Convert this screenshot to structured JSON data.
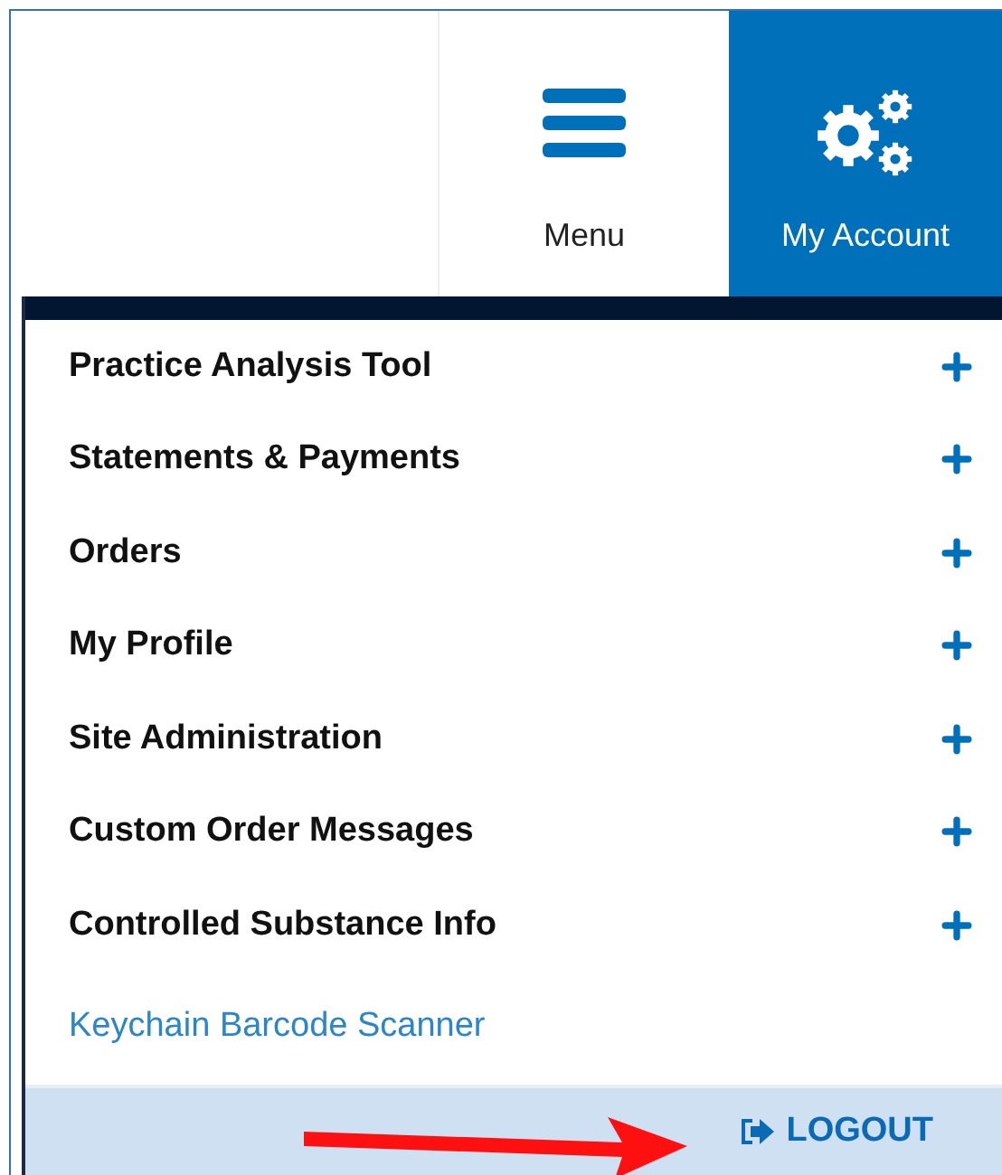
{
  "header_tabs": [
    {
      "kind": "menu",
      "label": "Menu",
      "selected": false
    },
    {
      "kind": "account",
      "label": "My Account",
      "selected": true
    }
  ],
  "account_menu": [
    {
      "kind": "section",
      "label": "Practice Analysis Tool"
    },
    {
      "kind": "section",
      "label": "Statements & Payments"
    },
    {
      "kind": "section",
      "label": "Orders"
    },
    {
      "kind": "section",
      "label": "My Profile"
    },
    {
      "kind": "section",
      "label": "Site Administration"
    },
    {
      "kind": "section",
      "label": "Custom Order Messages"
    },
    {
      "kind": "section",
      "label": "Controlled Substance Info"
    },
    {
      "kind": "link",
      "label": "Keychain Barcode Scanner"
    }
  ],
  "logout_button": {
    "label": "LOGOUT"
  }
}
